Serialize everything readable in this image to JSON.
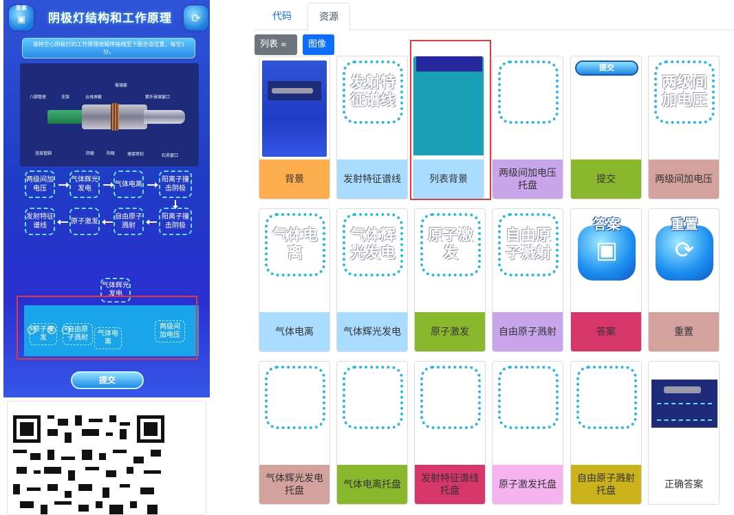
{
  "phone": {
    "title": "阴极灯结构和工作原理",
    "answer_label": "答案",
    "instruction": "请将空心阴极灯的工作原理按顺序拖拽至下图合适位置，每空1分。",
    "diagram_labels": [
      "八脚管座",
      "支架",
      "云母屏蔽",
      "玻璃套",
      "紫外玻璃窗口",
      "连接管脚",
      "阴极",
      "阳极",
      "速接密封",
      "石英窗口"
    ],
    "flow": {
      "row1": [
        "两级间加电压",
        "气体辉光发电",
        "气体电离",
        "阳离子撞击阴极"
      ],
      "row2": [
        "发射特征谱线",
        "原子激发",
        "自由原子溅射",
        "阳离子撞击阴极"
      ]
    },
    "floating_chip": "气体辉光发电",
    "tray_chips": [
      "原子激发",
      "自由原子溅射",
      "气体电离",
      "两级间加电压"
    ],
    "submit_label": "提交"
  },
  "tabs": [
    {
      "label": "代码",
      "active": false
    },
    {
      "label": "资源",
      "active": true
    }
  ],
  "view": {
    "list_label": "列表",
    "image_label": "图像"
  },
  "resources": [
    {
      "caption": "背景",
      "cap_color": "#ffae4e",
      "thumb": "background"
    },
    {
      "caption": "发射特征谱线",
      "cap_color": "#a9dcff",
      "thumb": "dash",
      "text": "发射特征谱线"
    },
    {
      "caption": "列表背景",
      "cap_color": "#a9dcff",
      "thumb": "teal"
    },
    {
      "caption": "两级间加电压托盘",
      "cap_color": "#c9a6ec",
      "thumb": "dash",
      "text": ""
    },
    {
      "caption": "提交",
      "cap_color": "#8ab82c",
      "thumb": "submit",
      "text": "提交"
    },
    {
      "caption": "两级间加电压",
      "cap_color": "#d4a29c",
      "thumb": "dash",
      "text": "两级间加电压"
    },
    {
      "caption": "气体电离",
      "cap_color": "#a9dcff",
      "thumb": "dash",
      "text": "气体电离"
    },
    {
      "caption": "气体辉光发电",
      "cap_color": "#a9dcff",
      "thumb": "dash",
      "text": "气体辉光发电"
    },
    {
      "caption": "原子激发",
      "cap_color": "#8ab82c",
      "thumb": "dash",
      "text": "原子激发"
    },
    {
      "caption": "自由原子溅射",
      "cap_color": "#c9a6ec",
      "thumb": "dash",
      "text": "自由原子溅射"
    },
    {
      "caption": "答案",
      "cap_color": "#d6366a",
      "thumb": "answer",
      "text": "答案"
    },
    {
      "caption": "重置",
      "cap_color": "#d4a29c",
      "thumb": "reset",
      "text": "重置"
    },
    {
      "caption": "气体辉光发电托盘",
      "cap_color": "#d4a29c",
      "thumb": "dash",
      "text": ""
    },
    {
      "caption": "气体电离托盘",
      "cap_color": "#8ab82c",
      "thumb": "dash",
      "text": ""
    },
    {
      "caption": "发射特征谱线托盘",
      "cap_color": "#d6366a",
      "thumb": "dash",
      "text": ""
    },
    {
      "caption": "原子激发托盘",
      "cap_color": "#f5b3f0",
      "thumb": "dash",
      "text": ""
    },
    {
      "caption": "自由原子溅射托盘",
      "cap_color": "#c9b21a",
      "thumb": "dash",
      "text": ""
    },
    {
      "caption": "正确答案",
      "cap_color": "#ffffff",
      "thumb": "correct"
    }
  ]
}
